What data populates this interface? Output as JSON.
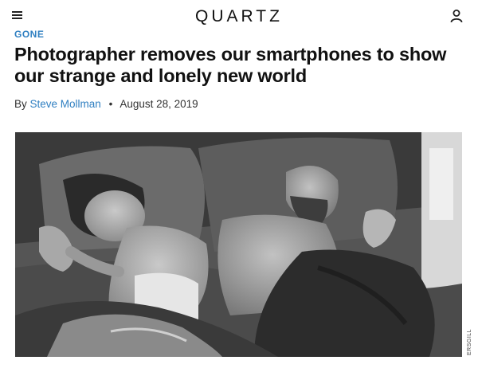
{
  "header": {
    "logo": "QUARTZ",
    "menu_icon": "hamburger-menu-icon",
    "account_icon": "user-icon"
  },
  "article": {
    "kicker": "GONE",
    "headline": "Photographer removes our smartphones to show our strange and lonely new world",
    "byline_prefix": "By",
    "author": "Steve Mollman",
    "separator": "•",
    "date": "August 28, 2019",
    "photo_credit": "ERSGILL"
  },
  "colors": {
    "accent": "#2f7fc1",
    "text": "#111111"
  }
}
